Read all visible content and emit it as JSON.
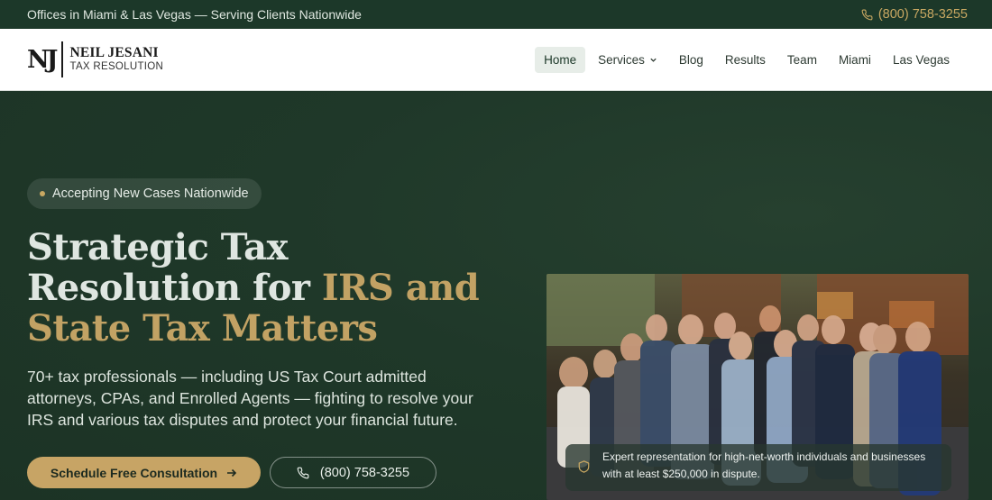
{
  "topbar": {
    "offices": "Offices in Miami & Las Vegas — Serving Clients Nationwide",
    "phone": "(800) 758-3255",
    "phone_icon": "phone-icon"
  },
  "logo": {
    "monogram": "NJ",
    "name": "NEIL JESANI",
    "subtitle": "TAX RESOLUTION"
  },
  "nav": {
    "items": [
      {
        "label": "Home",
        "active": true
      },
      {
        "label": "Services",
        "dropdown": true
      },
      {
        "label": "Blog"
      },
      {
        "label": "Results"
      },
      {
        "label": "Team"
      },
      {
        "label": "Miami"
      },
      {
        "label": "Las Vegas"
      }
    ]
  },
  "hero": {
    "badge": "Accepting New Cases Nationwide",
    "headline_line1": "Strategic Tax",
    "headline_line2_a": "Resolution for ",
    "headline_line2_b": "IRS and",
    "headline_line3": "State Tax Matters",
    "lead": "70+ tax professionals — including US Tax Court admitted attorneys, CPAs, and Enrolled Agents — fighting to resolve your IRS and various tax disputes and protect your financial future.",
    "cta_primary": "Schedule Free Consultation",
    "cta_phone": "(800) 758-3255",
    "photo_caption": "Expert representation for high-net-worth individuals and businesses with at least $250,000 in dispute."
  },
  "colors": {
    "dark_green": "#1c3829",
    "gold": "#c7a465",
    "header_bg": "#ffffff"
  }
}
